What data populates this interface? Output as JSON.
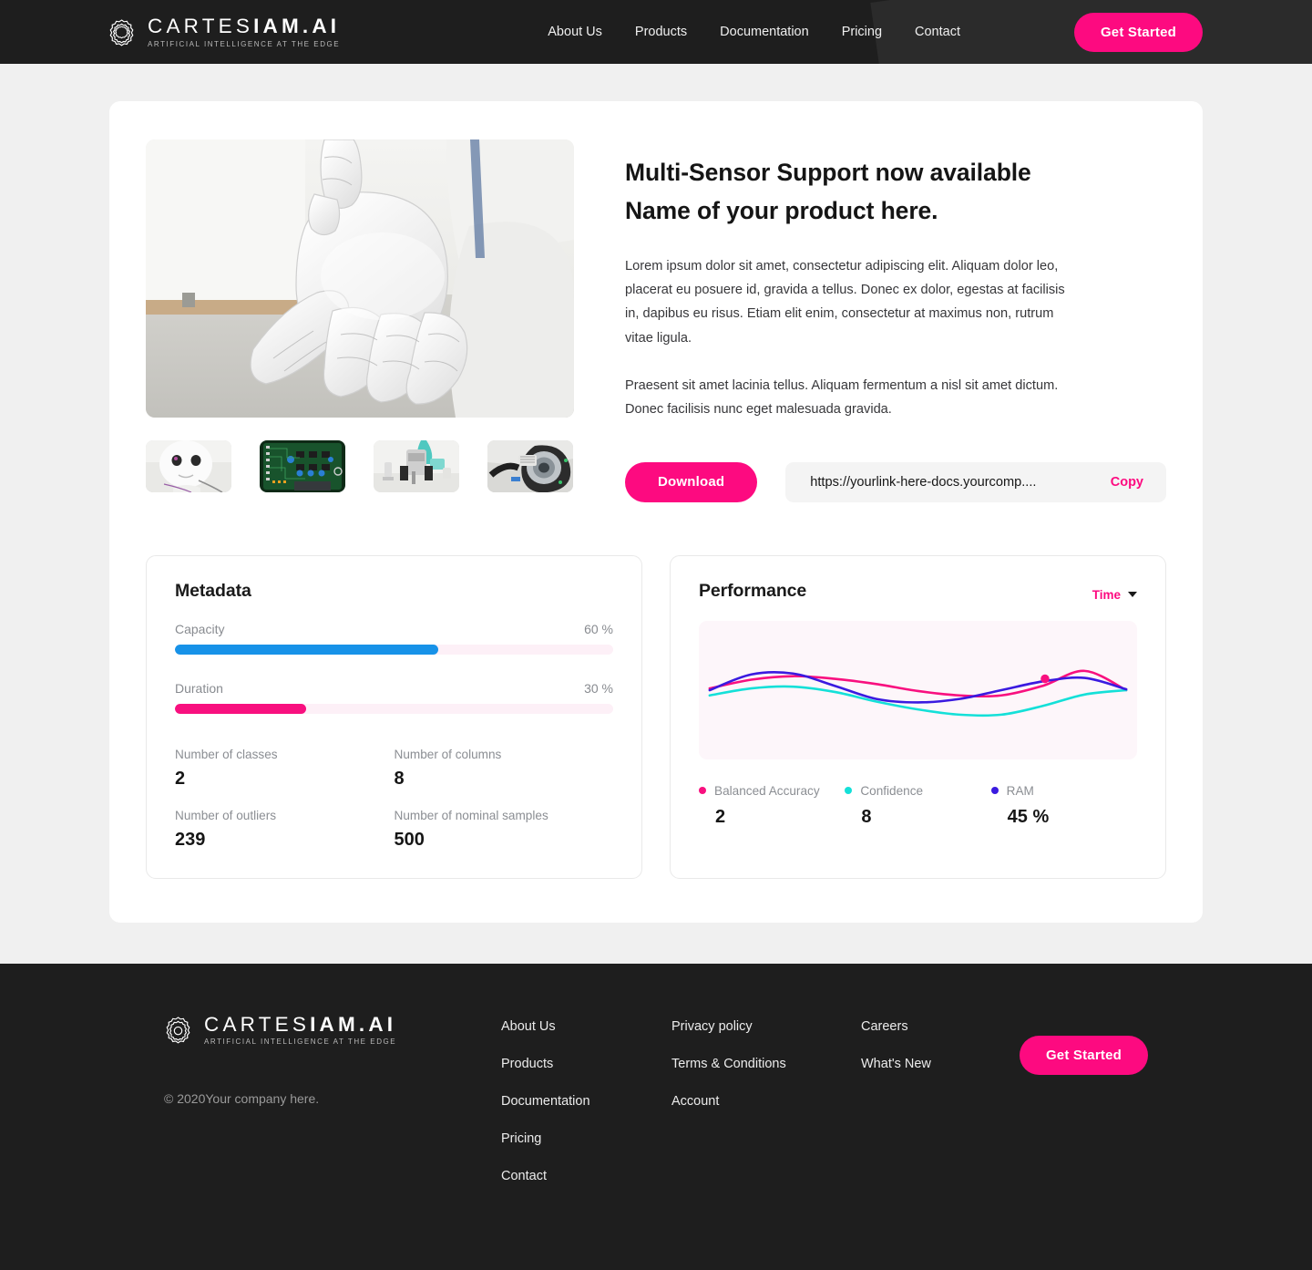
{
  "brand": {
    "name_light": "CARTES",
    "name_bold": "IAM.AI",
    "tagline": "ARTIFICIAL INTELLIGENCE AT THE EDGE",
    "logo_icon": "scalloped-flower-icon"
  },
  "header": {
    "nav": [
      {
        "label": "About Us"
      },
      {
        "label": "Products"
      },
      {
        "label": "Documentation"
      },
      {
        "label": "Pricing"
      },
      {
        "label": "Contact"
      }
    ],
    "cta_label": "Get Started"
  },
  "hero": {
    "image_alt": "white-robotic-hand-photo",
    "thumbnails": [
      {
        "alt": "white-robot-head-thumbnail"
      },
      {
        "alt": "green-circuit-board-thumbnail"
      },
      {
        "alt": "robotic-gripper-thumbnail"
      },
      {
        "alt": "camera-lens-module-thumbnail"
      }
    ],
    "title_line1": "Multi-Sensor Support now available",
    "title_line2": "Name of your product here.",
    "paragraph1": "Lorem ipsum dolor sit amet, consectetur adipiscing elit. Aliquam dolor leo, placerat eu posuere id, gravida a tellus. Donec ex dolor, egestas at facilisis in, dapibus eu risus. Etiam elit enim, consectetur at maximus non, rutrum vitae ligula.",
    "paragraph2": "Praesent sit amet lacinia tellus. Aliquam fermentum a nisl sit amet dictum. Donec facilisis nunc eget malesuada gravida.",
    "download_label": "Download",
    "link_value": "https://yourlink-here-docs.yourcomp....",
    "copy_label": "Copy"
  },
  "metadata": {
    "title": "Metadata",
    "bars": [
      {
        "name": "Capacity",
        "value_label": "60 %",
        "percent": 60,
        "color": "#1792e8"
      },
      {
        "name": "Duration",
        "value_label": "30 %",
        "percent": 30,
        "color": "#f8107f"
      }
    ],
    "track_color": "#fdf0f7",
    "stats": [
      {
        "label": "Number of classes",
        "value": "2"
      },
      {
        "label": "Number of columns",
        "value": "8"
      },
      {
        "label": "Number of outliers",
        "value": "239"
      },
      {
        "label": "Number of nominal samples",
        "value": "500"
      }
    ]
  },
  "performance": {
    "title": "Performance",
    "range_label": "Time",
    "range_caret_icon": "chevron-down-icon",
    "plot_background": "#fdf6fa",
    "legend": [
      {
        "name": "Balanced Accuracy",
        "value": "2",
        "color": "#f8107f"
      },
      {
        "name": "Confidence",
        "value": "8",
        "color": "#14e0d8"
      },
      {
        "name": "RAM",
        "value": "45 %",
        "color": "#3a1ae0"
      }
    ]
  },
  "chart_data": {
    "type": "line",
    "title": "Performance",
    "xlabel": "",
    "ylabel": "",
    "grid": false,
    "legend_position": "bottom",
    "x": [
      0,
      1,
      2,
      3,
      4,
      5,
      6,
      7,
      8,
      9,
      10
    ],
    "xlim": [
      0,
      10
    ],
    "ylim": [
      0,
      100
    ],
    "series": [
      {
        "name": "Balanced Accuracy",
        "color": "#f8107f",
        "values": [
          52,
          62,
          66,
          63,
          57,
          49,
          44,
          44,
          55,
          72,
          50
        ],
        "marker": {
          "x": 8.05,
          "y": 63,
          "color": "#f8107f"
        }
      },
      {
        "name": "Confidence",
        "color": "#14e0d8",
        "values": [
          44,
          52,
          54,
          48,
          37,
          28,
          22,
          22,
          32,
          45,
          50
        ]
      },
      {
        "name": "RAM",
        "color": "#3a1ae0",
        "values": [
          50,
          68,
          69,
          55,
          40,
          36,
          40,
          50,
          60,
          64,
          51
        ]
      }
    ]
  },
  "footer": {
    "copyright": "© 2020Your company here.",
    "columns": [
      {
        "links": [
          {
            "label": "About Us"
          },
          {
            "label": "Products"
          },
          {
            "label": "Documentation"
          },
          {
            "label": "Pricing"
          },
          {
            "label": "Contact"
          }
        ]
      },
      {
        "links": [
          {
            "label": "Privacy policy"
          },
          {
            "label": "Terms & Conditions"
          },
          {
            "label": "Account"
          }
        ]
      },
      {
        "links": [
          {
            "label": "Careers"
          },
          {
            "label": "What's New"
          }
        ]
      }
    ],
    "cta_label": "Get Started"
  },
  "colors": {
    "accent_pink": "#fd0a80",
    "dark": "#1e1e1e",
    "page_bg": "#f0f0f0",
    "blue": "#1792e8",
    "cyan": "#14e0d8",
    "indigo": "#3a1ae0"
  }
}
